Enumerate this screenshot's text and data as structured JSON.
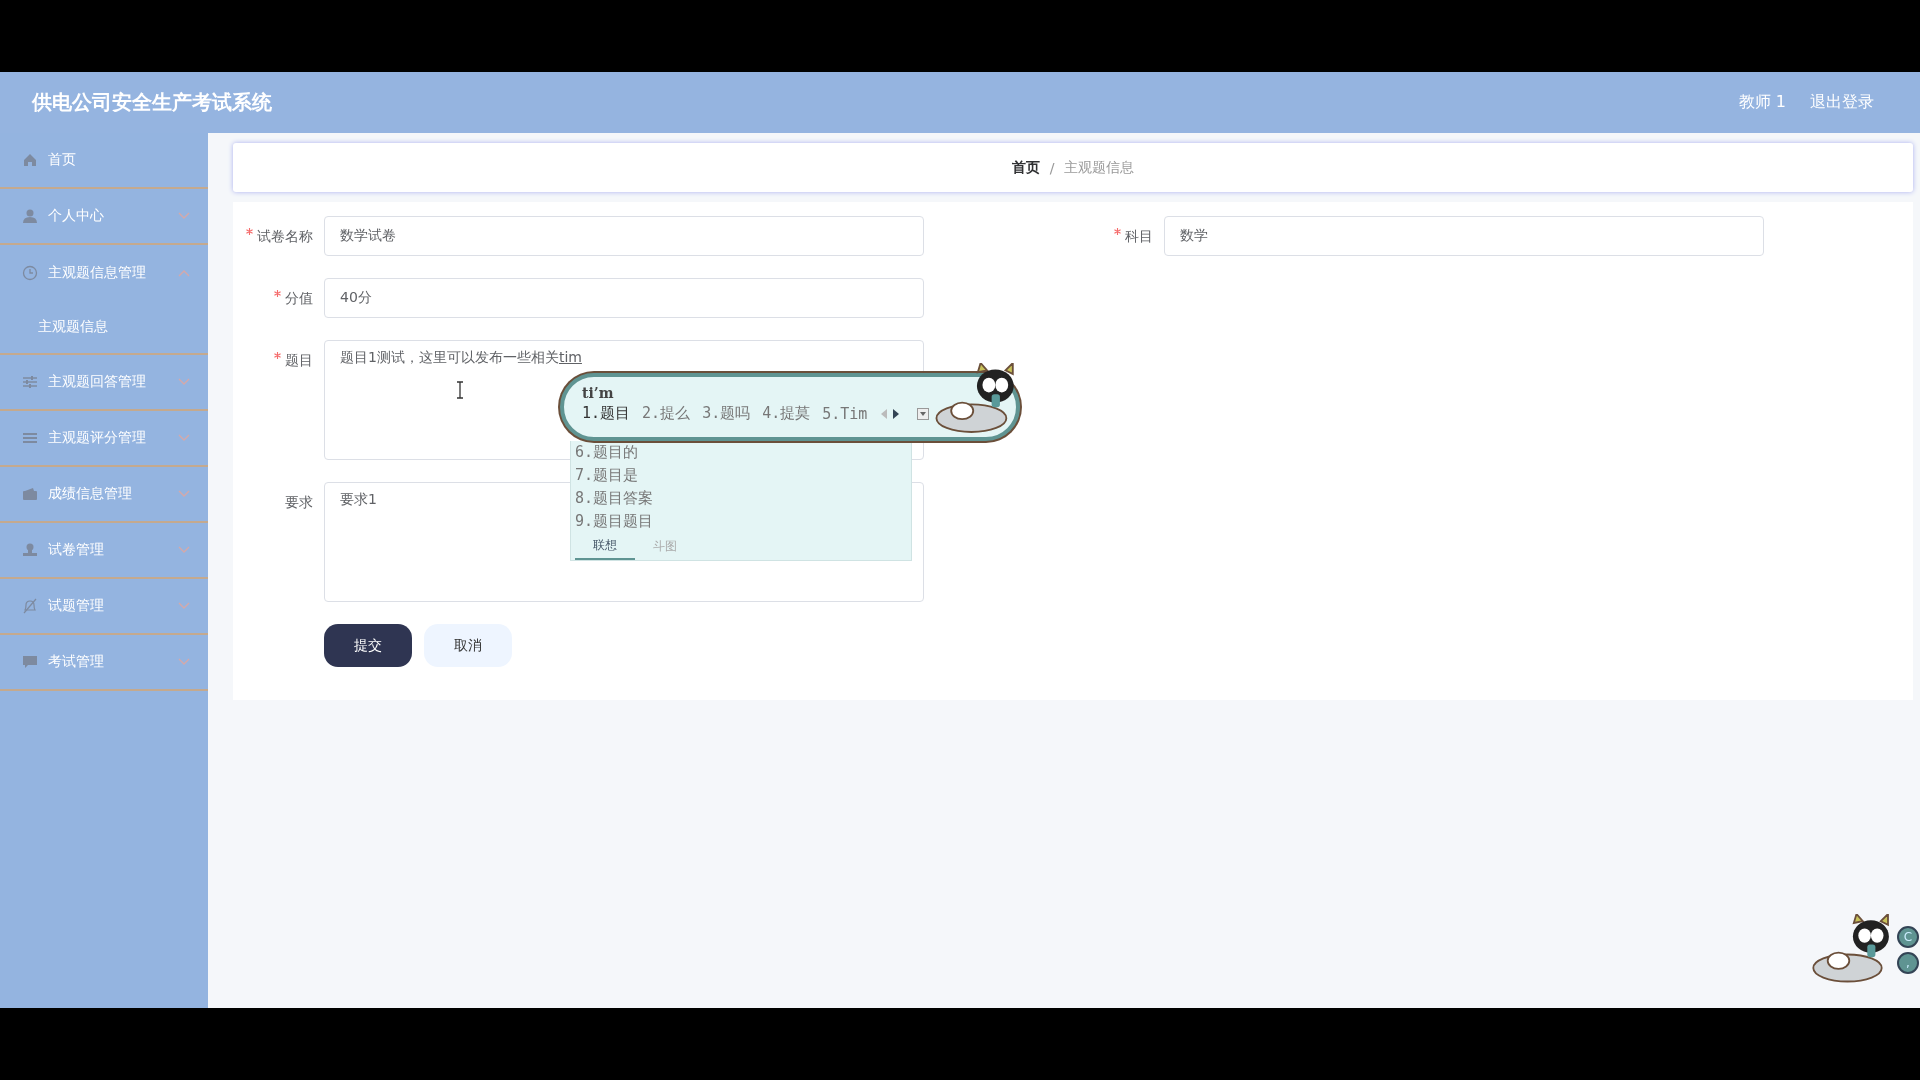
{
  "header": {
    "title": "供电公司安全生产考试系统",
    "user": "教师 1",
    "logout": "退出登录"
  },
  "sidebar": {
    "items": [
      {
        "label": "首页",
        "kind": "link"
      },
      {
        "label": "个人中心",
        "kind": "menu",
        "expanded": false
      },
      {
        "label": "主观题信息管理",
        "kind": "menu",
        "expanded": true,
        "children": [
          {
            "label": "主观题信息"
          }
        ]
      },
      {
        "label": "主观题回答管理",
        "kind": "menu",
        "expanded": false
      },
      {
        "label": "主观题评分管理",
        "kind": "menu",
        "expanded": false
      },
      {
        "label": "成绩信息管理",
        "kind": "menu",
        "expanded": false
      },
      {
        "label": "试卷管理",
        "kind": "menu",
        "expanded": false
      },
      {
        "label": "试题管理",
        "kind": "menu",
        "expanded": false
      },
      {
        "label": "考试管理",
        "kind": "menu",
        "expanded": false
      }
    ]
  },
  "breadcrumb": {
    "items": [
      "首页",
      "主观题信息"
    ],
    "separator": "/"
  },
  "form": {
    "fields": [
      {
        "label": "试卷名称",
        "required": true,
        "kind": "input",
        "value": "数学试卷"
      },
      {
        "label": "科目",
        "required": true,
        "kind": "input",
        "value": "数学"
      },
      {
        "label": "分值",
        "required": true,
        "kind": "input",
        "value": "40分"
      },
      {
        "label": "题目",
        "required": true,
        "kind": "textarea",
        "value": "题目1测试，这里可以发布一些相关",
        "composition": "tim"
      },
      {
        "label": "要求",
        "required": false,
        "kind": "textarea",
        "value": "要求1"
      }
    ],
    "buttons": [
      {
        "label": "提交",
        "kind": "primary"
      },
      {
        "label": "取消",
        "kind": "secondary"
      }
    ]
  },
  "ime": {
    "input": "ti’m",
    "candidates": [
      {
        "label": "1.题目",
        "selected": true
      },
      {
        "label": "2.提么",
        "selected": false
      },
      {
        "label": "3.题吗",
        "selected": false
      },
      {
        "label": "4.提莫",
        "selected": false
      },
      {
        "label": "5.Tim",
        "selected": false
      }
    ],
    "more": [
      "6.题目的",
      "7.题目是",
      "8.题目答案",
      "9.题目题目"
    ],
    "tabs": [
      {
        "label": "联想",
        "selected": true
      },
      {
        "label": "斗图",
        "selected": false
      }
    ]
  },
  "floating_buttons": [
    "C",
    ","
  ]
}
